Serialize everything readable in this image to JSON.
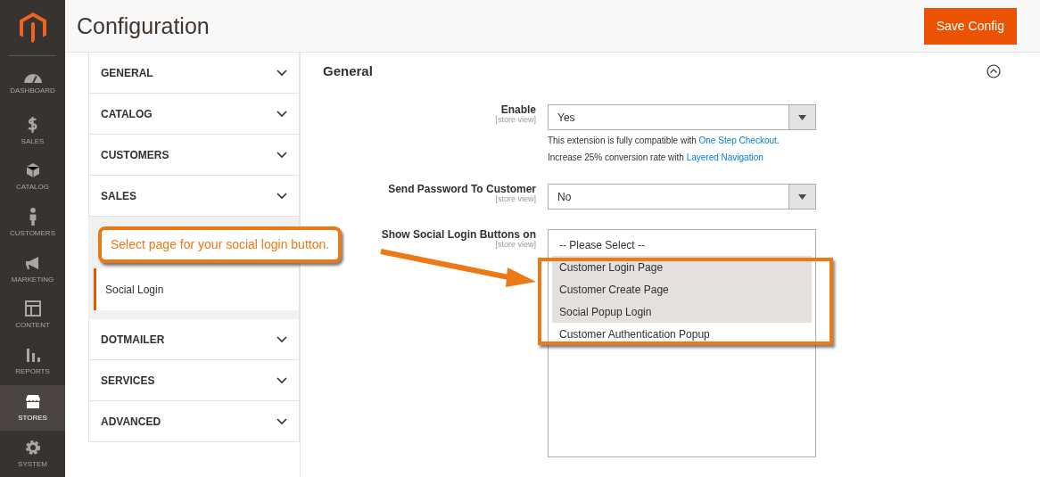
{
  "sidebar": {
    "items": [
      {
        "label": "DASHBOARD",
        "selected": false
      },
      {
        "label": "SALES",
        "selected": false
      },
      {
        "label": "CATALOG",
        "selected": false
      },
      {
        "label": "CUSTOMERS",
        "selected": false
      },
      {
        "label": "MARKETING",
        "selected": false
      },
      {
        "label": "CONTENT",
        "selected": false
      },
      {
        "label": "REPORTS",
        "selected": false
      },
      {
        "label": "STORES",
        "selected": true
      },
      {
        "label": "SYSTEM",
        "selected": false
      }
    ]
  },
  "page_title": "Configuration",
  "save_button": "Save Config",
  "config_nav": [
    {
      "kind": "group",
      "label": "GENERAL"
    },
    {
      "kind": "group",
      "label": "CATALOG"
    },
    {
      "kind": "group",
      "label": "CUSTOMERS"
    },
    {
      "kind": "group",
      "label": "SALES"
    },
    {
      "kind": "open_group",
      "children": [
        {
          "label": "Social Login",
          "selected": true
        }
      ]
    },
    {
      "kind": "group",
      "label": "DOTMAILER"
    },
    {
      "kind": "group",
      "label": "SERVICES"
    },
    {
      "kind": "group",
      "label": "ADVANCED"
    }
  ],
  "section": {
    "title": "General",
    "expanded": true,
    "fields": [
      {
        "kind": "select",
        "label": "Enable",
        "scope": "[store view]",
        "value": "Yes",
        "note": [
          [
            {
              "kind": "text",
              "text": "This extension is fully compatible with "
            },
            {
              "kind": "link",
              "text": "One Step Checkout"
            },
            {
              "kind": "text",
              "text": "."
            }
          ],
          [
            {
              "kind": "text",
              "text": "Increase 25% conversion rate with "
            },
            {
              "kind": "link",
              "text": "Layered Navigation"
            }
          ]
        ]
      },
      {
        "kind": "select",
        "label": "Send Password To Customer",
        "scope": "[store view]",
        "value": "No"
      },
      {
        "kind": "multiselect",
        "label": "Show Social Login Buttons on",
        "scope": "[store view]",
        "options": [
          {
            "label": "-- Please Select --",
            "selected": false
          },
          {
            "label": "Customer Login Page",
            "selected": true
          },
          {
            "label": "Customer Create Page",
            "selected": true
          },
          {
            "label": "Social Popup Login",
            "selected": true
          },
          {
            "label": "Customer Authentication Popup",
            "selected": false
          }
        ]
      }
    ]
  },
  "callout": {
    "text": "Select page for your social login button."
  }
}
